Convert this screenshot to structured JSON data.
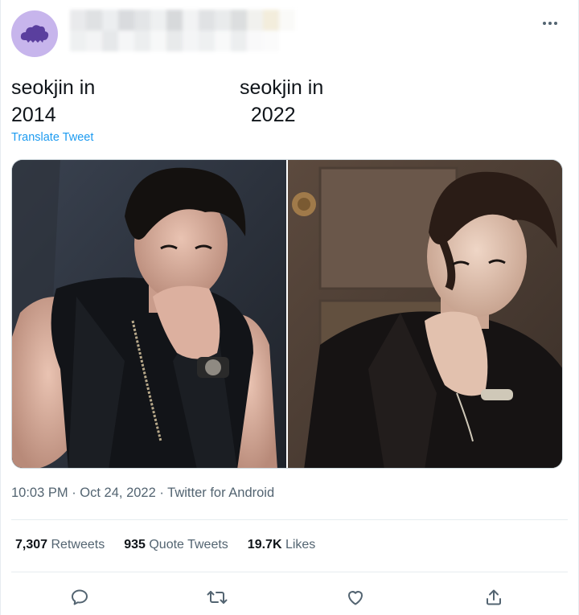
{
  "tweet": {
    "caption_left": "seokjin in\n2014",
    "caption_right": "seokjin in\n  2022",
    "translate_label": "Translate Tweet",
    "time": "10:03 PM",
    "date": "Oct 24, 2022",
    "source": "Twitter for Android",
    "separator": " · "
  },
  "stats": {
    "retweets_count": "7,307",
    "retweets_label": "Retweets",
    "quotes_count": "935",
    "quotes_label": "Quote Tweets",
    "likes_count": "19.7K",
    "likes_label": "Likes"
  },
  "icons": {
    "avatar": "cloud-icon",
    "more": "more-horizontal-icon",
    "reply": "reply-icon",
    "retweet": "retweet-icon",
    "like": "heart-icon",
    "share": "share-icon"
  },
  "colors": {
    "link": "#1d9bf0",
    "text": "#0f1419",
    "muted": "#536471",
    "avatar_bg": "#c7b5ec",
    "avatar_cloud": "#5a3f9e"
  }
}
